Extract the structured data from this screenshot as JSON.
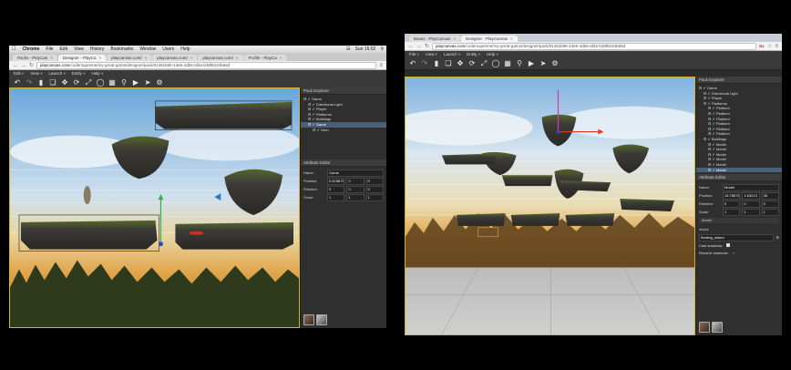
{
  "left_window": {
    "menubar": {
      "app_name": "Chrome",
      "items": [
        "File",
        "Edit",
        "View",
        "History",
        "Bookmarks",
        "Window",
        "Users",
        "Help"
      ],
      "clock": "Sun 16:02"
    },
    "tabs": [
      {
        "title": "Packs - PlayCan",
        "active": false
      },
      {
        "title": "Designer - PlayCa",
        "active": true
      },
      {
        "title": "playcanvas.com/",
        "active": false
      },
      {
        "title": "playcanvas.com/",
        "active": false
      },
      {
        "title": "playcanvas.com/",
        "active": false
      },
      {
        "title": "Profile - PlayCa",
        "active": false
      }
    ],
    "url": {
      "host": "playcanvas.com",
      "path": "/codersupreme/my-great-game/designer/pack/81351b86-43e6-4db5-af3a-b38f6234b66d"
    },
    "app_menu": [
      "Edit",
      "View",
      "Launch",
      "Entity",
      "Help"
    ],
    "pack_explorer": {
      "title": "Pack Explorer",
      "nodes": [
        {
          "label": "Game",
          "depth": 0,
          "selected": false
        },
        {
          "label": "Directional Light",
          "depth": 1,
          "selected": false
        },
        {
          "label": "Player",
          "depth": 1,
          "selected": false
        },
        {
          "label": "Platforms",
          "depth": 1,
          "selected": false
        },
        {
          "label": "Buildings",
          "depth": 1,
          "selected": false
        },
        {
          "label": "Game",
          "depth": 1,
          "selected": true
        },
        {
          "label": "Gem",
          "depth": 2,
          "selected": false
        }
      ]
    },
    "attribute_editor": {
      "title": "Attribute Editor",
      "name_label": "Name:",
      "name_value": "Game",
      "position_label": "Position:",
      "position": [
        "0.878879",
        "0",
        "0"
      ],
      "rotation_label": "Rotation:",
      "rotation": [
        "0",
        "0",
        "0"
      ],
      "scale_label": "Scale:",
      "scale": [
        "1",
        "1",
        "1"
      ]
    }
  },
  "right_window": {
    "tabs": [
      {
        "title": "Boxes - PlayCanvas",
        "active": false
      },
      {
        "title": "Designer - PlayCanvas",
        "active": true
      }
    ],
    "url": {
      "host": "playcanvas.com",
      "path": "/codersupreme/my-great-game/designer/pack/81351b86-43e6-4db5-af3a-b38f6234b66d"
    },
    "extension_label": "GL",
    "app_menu": [
      "File",
      "View",
      "Launch",
      "Entity",
      "Help"
    ],
    "pack_explorer": {
      "title": "Pack Explorer",
      "nodes": [
        {
          "label": "Game",
          "depth": 0,
          "selected": false
        },
        {
          "label": "Directional Light",
          "depth": 1,
          "selected": false
        },
        {
          "label": "Player",
          "depth": 1,
          "selected": false
        },
        {
          "label": "Platforms",
          "depth": 1,
          "selected": false
        },
        {
          "label": "Platform",
          "depth": 2,
          "selected": false
        },
        {
          "label": "Platform",
          "depth": 2,
          "selected": false
        },
        {
          "label": "Platform",
          "depth": 2,
          "selected": false
        },
        {
          "label": "Platform",
          "depth": 2,
          "selected": false
        },
        {
          "label": "Platform",
          "depth": 2,
          "selected": false
        },
        {
          "label": "Platform",
          "depth": 2,
          "selected": false
        },
        {
          "label": "Buildings",
          "depth": 1,
          "selected": false
        },
        {
          "label": "Model",
          "depth": 2,
          "selected": false
        },
        {
          "label": "Model",
          "depth": 2,
          "selected": false
        },
        {
          "label": "Model",
          "depth": 2,
          "selected": false
        },
        {
          "label": "Model",
          "depth": 2,
          "selected": false
        },
        {
          "label": "Model",
          "depth": 2,
          "selected": false
        },
        {
          "label": "Model",
          "depth": 2,
          "selected": true
        }
      ]
    },
    "attribute_editor": {
      "title": "Attribute Editor",
      "name_label": "Name:",
      "name_value": "Model",
      "position_label": "Position:",
      "position": [
        "15.78678",
        "1.63213",
        "35"
      ],
      "rotation_label": "Rotation:",
      "rotation": [
        "0",
        "0",
        "0"
      ],
      "scale_label": "Scale:",
      "scale": [
        "1",
        "1",
        "1"
      ],
      "model_section": "Model",
      "asset_label": "Asset:",
      "asset_value": "floating_island",
      "cast_shadows_label": "Cast shadows:",
      "receive_shadows_label": "Receive shadows:"
    }
  },
  "colors": {
    "panel_bg": "#2f2f2f",
    "toolbar_bg": "#3a3a3a",
    "viewport_border": "#d6b13a",
    "selection": "#4a5f7a",
    "sky_top": "#7fb2df",
    "horizon_orange": "#e0a347",
    "foliage": "#55672a",
    "rock": "#3d3b37"
  },
  "toolbar_icons": [
    "undo-icon",
    "redo-icon",
    "delete-icon",
    "duplicate-icon",
    "move-icon",
    "rotate-icon",
    "scale-icon",
    "world-icon",
    "grid-icon",
    "zoom-icon",
    "play-icon",
    "publish-icon",
    "settings-icon"
  ]
}
